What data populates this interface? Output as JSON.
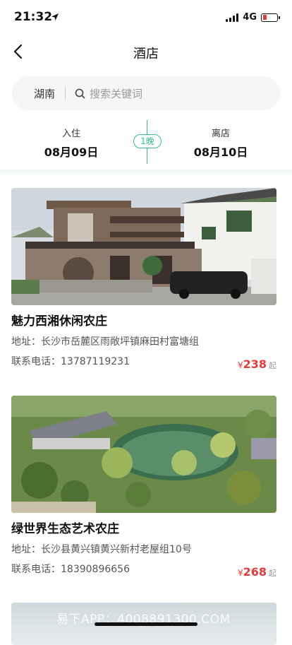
{
  "status": {
    "time": "21:32",
    "network": "4G"
  },
  "nav": {
    "title": "酒店"
  },
  "search": {
    "city": "湖南",
    "placeholder": "搜索关键词"
  },
  "dates": {
    "checkin_label": "入住",
    "checkin_value": "08月09日",
    "nights": "1晚",
    "checkout_label": "离店",
    "checkout_value": "08月10日"
  },
  "colors": {
    "accent": "#2fc08b",
    "price": "#e83a3a"
  },
  "hotels": [
    {
      "name": "魅力西湘休闲农庄",
      "address": "地址：长沙市岳麓区雨敞坪镇麻田村富塘组",
      "phone": "联系电话：13787119231",
      "currency": "¥",
      "price": "238",
      "suffix": "起"
    },
    {
      "name": "绿世界生态艺术农庄",
      "address": "地址：长沙县黄兴镇黄兴新村老屋组10号",
      "phone": "联系电话：18390896656",
      "currency": "¥",
      "price": "268",
      "suffix": "起"
    }
  ],
  "watermark": "易下APP：4008891300.COM"
}
